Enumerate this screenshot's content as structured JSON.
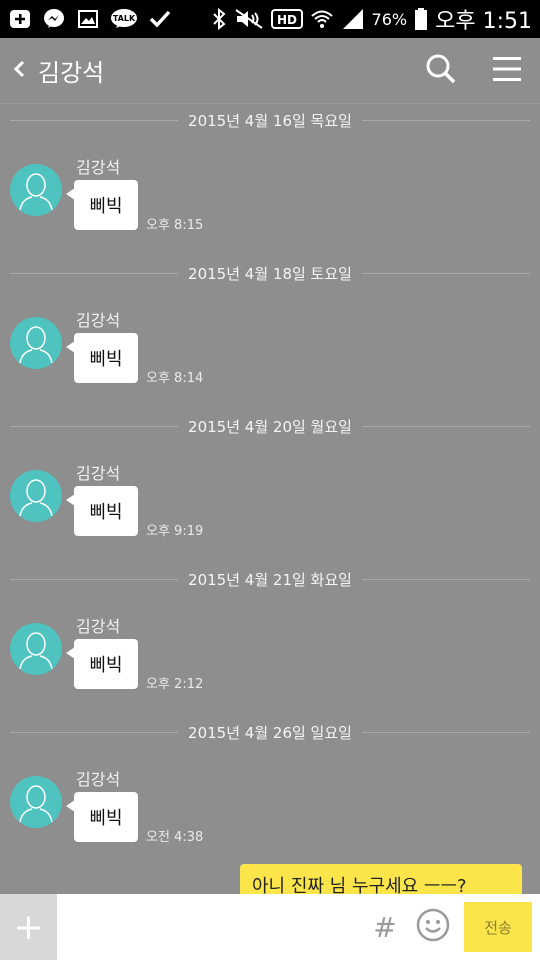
{
  "status_bar": {
    "battery": "76%",
    "time": "오후 1:51",
    "left_icons": [
      "add-notification-icon",
      "messenger-icon",
      "image-icon",
      "talk-icon",
      "check-icon"
    ],
    "right_icons": [
      "bluetooth-icon",
      "mute-icon",
      "hd-icon",
      "wifi-icon",
      "signal-icon",
      "battery-icon"
    ]
  },
  "header": {
    "title": "김강석",
    "icons": [
      "back-icon",
      "search-icon",
      "menu-icon"
    ]
  },
  "colors": {
    "background": "#8e8e8e",
    "avatar": "#4fc3c0",
    "my_bubble": "#fbe54a",
    "send_button": "#fbe54a"
  },
  "messages": [
    {
      "date": "2015년 4월 16일 목요일",
      "sender": "김강석",
      "text": "삐빅",
      "time": "오후 8:15"
    },
    {
      "date": "2015년 4월 18일 토요일",
      "sender": "김강석",
      "text": "삐빅",
      "time": "오후 8:14"
    },
    {
      "date": "2015년 4월 20일 월요일",
      "sender": "김강석",
      "text": "삐빅",
      "time": "오후 9:19"
    },
    {
      "date": "2015년 4월 21일 화요일",
      "sender": "김강석",
      "text": "삐빅",
      "time": "오후 2:12"
    },
    {
      "date": "2015년 4월 26일 일요일",
      "sender": "김강석",
      "text": "삐빅",
      "time": "오전 4:38"
    }
  ],
  "my_message": {
    "text": "아니 진짜 님 누구세요 ㅡㅡ?"
  },
  "input_bar": {
    "plus_label": "+",
    "hash_label": "#",
    "send_label": "전송",
    "placeholder": ""
  }
}
